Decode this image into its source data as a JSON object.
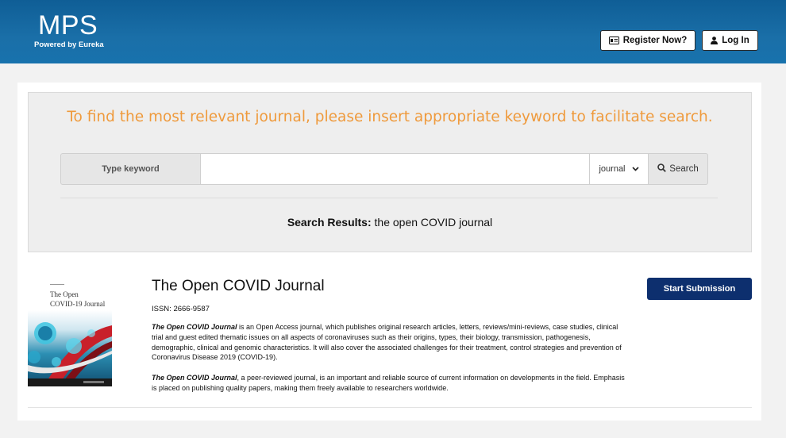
{
  "header": {
    "logo_title": "MPS",
    "logo_subtitle": "Powered by Eureka",
    "register_label": "Register Now?",
    "login_label": "Log In"
  },
  "search": {
    "tagline": "To find the most relevant journal, please insert appropriate keyword to facilitate search.",
    "keyword_label": "Type keyword",
    "keyword_value": "",
    "type_selected": "journal",
    "button_label": "Search",
    "results_label": "Search Results:",
    "results_query": "the open COVID journal"
  },
  "result": {
    "cover_line1": "The Open",
    "cover_line2": "COVID-19 Journal",
    "title": "The Open COVID Journal",
    "issn": "ISSN: 2666-9587",
    "desc1_name": "The Open COVID Journal",
    "desc1_text": " is an Open Access journal, which publishes original research articles, letters, reviews/mini-reviews, case studies, clinical trial and guest edited thematic issues on all aspects of coronaviruses such as their origins, types, their biology, transmission, pathogenesis, demographic, clinical and genomic characteristics. It will also cover the associated challenges for their treatment, control strategies and prevention of Coronavirus Disease 2019 (COVID-19).",
    "desc2_name": "The Open COVID Journal",
    "desc2_text": ", a peer-reviewed journal, is an important and reliable source of current information on developments in the field. Emphasis is placed on publishing quality papers, making them freely available to researchers worldwide.",
    "submit_label": "Start Submission"
  },
  "colors": {
    "header_blue": "#1872ad",
    "tagline_orange": "#ef9a3c",
    "submit_navy": "#0d2f6e"
  }
}
